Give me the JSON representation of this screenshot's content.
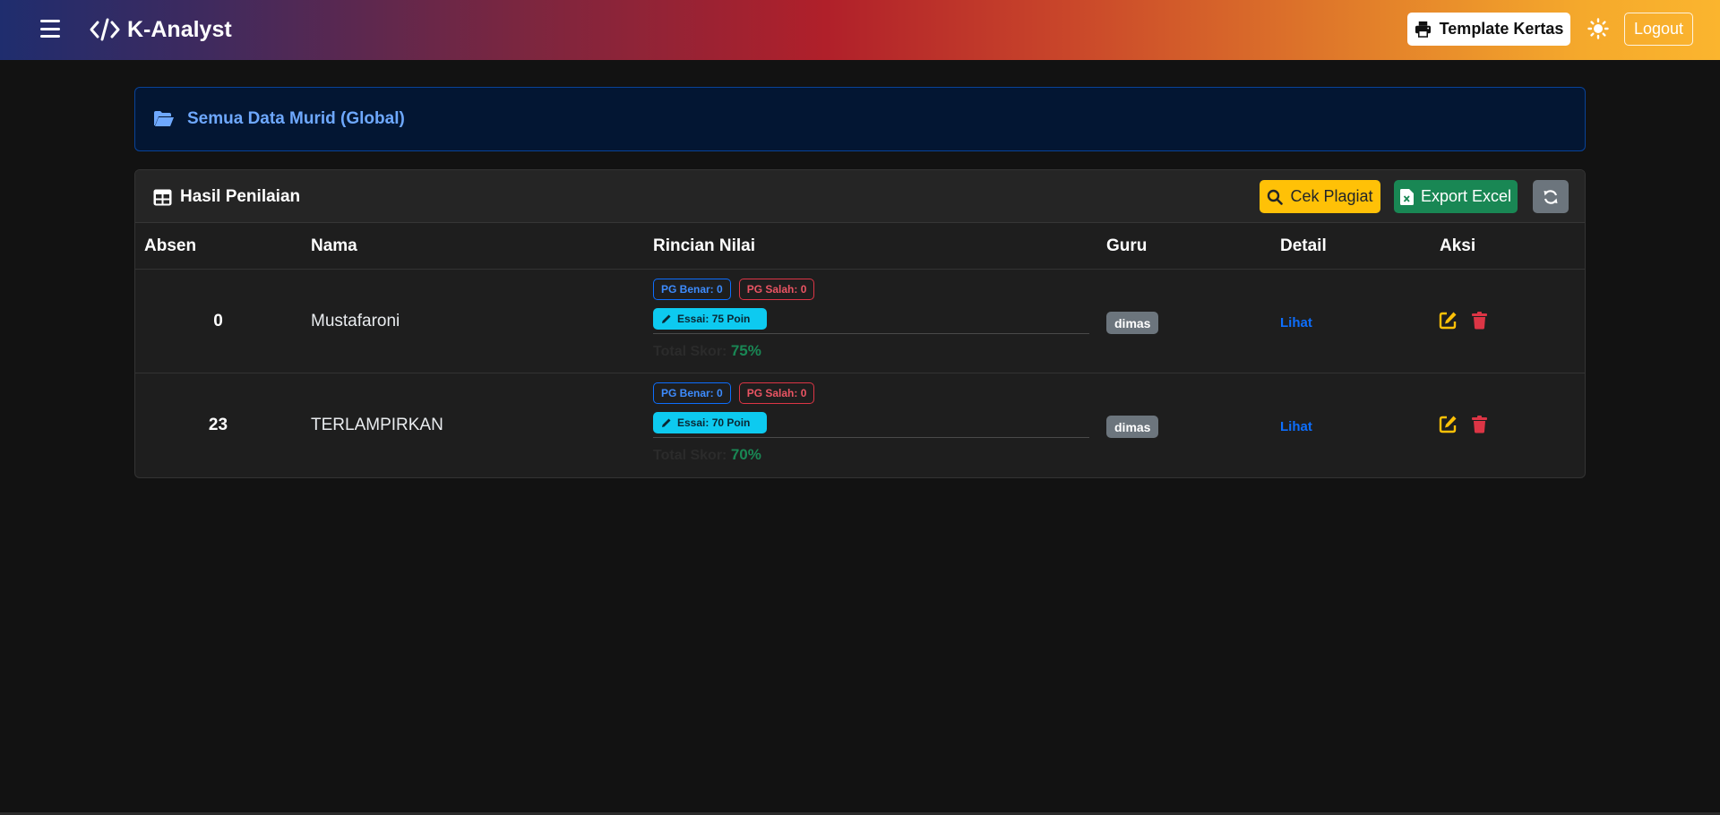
{
  "navbar": {
    "brand": "K-Analyst",
    "template_button": "Template Kertas",
    "logout_button": "Logout",
    "icons": {
      "menu": "hamburger-icon",
      "brand": "code-icon",
      "template": "printer-icon",
      "theme": "sun-icon"
    }
  },
  "banner": {
    "icon": "folder-open-icon",
    "title": "Semua Data Murid (Global)"
  },
  "card": {
    "title": "Hasil Penilaian",
    "icon": "table-icon",
    "buttons": {
      "plagiat": "Cek Plagiat",
      "excel": "Export Excel",
      "refresh_icon": "refresh-icon"
    }
  },
  "table": {
    "headers": [
      "Absen",
      "Nama",
      "Rincian Nilai",
      "Guru",
      "Detail",
      "Aksi"
    ],
    "rows": [
      {
        "absen": "0",
        "nama": "Mustafaroni",
        "pg_benar": "PG Benar: 0",
        "pg_salah": "PG Salah: 0",
        "essai": "Essai: 75 Poin",
        "total_label": "Total Skor:",
        "total_value": "75%",
        "guru": "dimas",
        "detail": "Lihat"
      },
      {
        "absen": "23",
        "nama": "TERLAMPIRKAN",
        "pg_benar": "PG Benar: 0",
        "pg_salah": "PG Salah: 0",
        "essai": "Essai: 70 Poin",
        "total_label": "Total Skor:",
        "total_value": "70%",
        "guru": "dimas",
        "detail": "Lihat"
      }
    ]
  },
  "colors": {
    "accent_blue": "#6ea8fe",
    "warning": "#ffc107",
    "success": "#198754",
    "danger": "#dc3545",
    "info": "#0dcaf0",
    "secondary": "#6c757d"
  }
}
